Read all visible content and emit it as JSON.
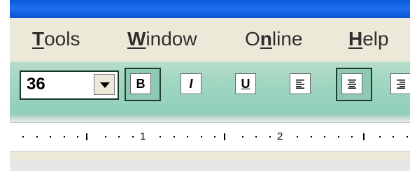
{
  "menu": {
    "items": [
      {
        "mnemonic": "T",
        "rest": "ools"
      },
      {
        "mnemonic": "W",
        "rest": "indow"
      },
      {
        "pre": "O",
        "mnemonic": "n",
        "rest": "line"
      },
      {
        "mnemonic": "H",
        "rest": "elp"
      }
    ]
  },
  "format_toolbar": {
    "font_size": "36",
    "bold_label": "B",
    "italic_label": "I",
    "underline_label": "U"
  },
  "ruler": {
    "labels": [
      "1",
      "2"
    ]
  },
  "colors": {
    "titlebar": "#0a5ad7",
    "toolbar": "#a3d7c2",
    "menubar": "#ece9d8"
  }
}
